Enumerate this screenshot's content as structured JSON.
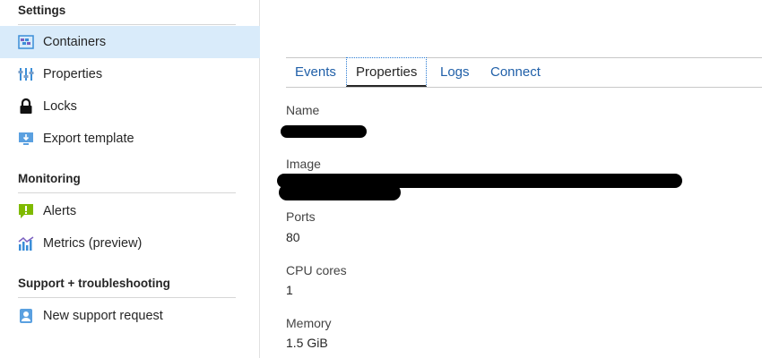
{
  "sidebar": {
    "sections": [
      {
        "title": "Settings"
      },
      {
        "title": "Monitoring"
      },
      {
        "title": "Support + troubleshooting"
      }
    ],
    "items": [
      {
        "label": "Containers",
        "icon": "containers-icon",
        "active": true
      },
      {
        "label": "Properties",
        "icon": "properties-icon"
      },
      {
        "label": "Locks",
        "icon": "lock-icon"
      },
      {
        "label": "Export template",
        "icon": "export-template-icon"
      },
      {
        "label": "Alerts",
        "icon": "alerts-icon"
      },
      {
        "label": "Metrics (preview)",
        "icon": "metrics-icon"
      },
      {
        "label": "New support request",
        "icon": "support-request-icon"
      }
    ]
  },
  "main": {
    "tabs": [
      {
        "label": "Events"
      },
      {
        "label": "Properties",
        "selected": true
      },
      {
        "label": "Logs"
      },
      {
        "label": "Connect"
      }
    ],
    "properties": [
      {
        "label": "Name",
        "value": ""
      },
      {
        "label": "Image",
        "value": ""
      },
      {
        "label": "Ports",
        "value": "80"
      },
      {
        "label": "CPU cores",
        "value": "1"
      },
      {
        "label": "Memory",
        "value": "1.5 GiB"
      }
    ]
  },
  "colors": {
    "active_item_bg": "#d9ebfa",
    "link": "#1f5fa8",
    "alert_green": "#7fba00",
    "icon_blue": "#3b8ed8"
  }
}
